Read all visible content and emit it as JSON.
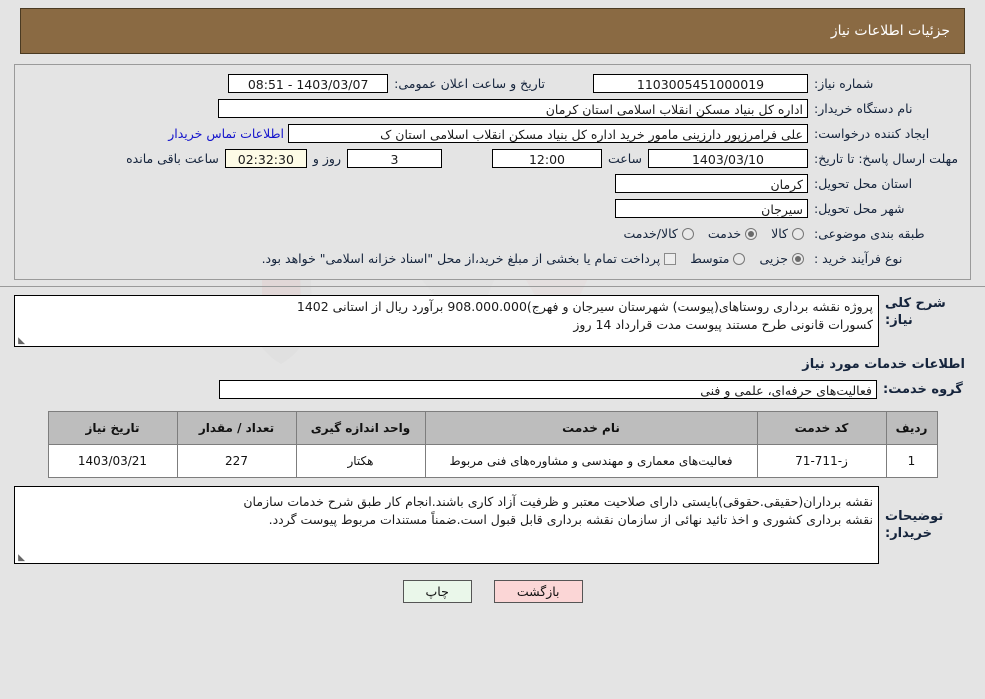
{
  "header": {
    "title": "جزئیات اطلاعات نیاز"
  },
  "fields": {
    "need_number_label": "شماره نیاز:",
    "need_number_value": "1103005451000019",
    "announce_label": "تاریخ و ساعت اعلان عمومی:",
    "announce_value": "1403/03/07 - 08:51",
    "buyer_org_label": "نام دستگاه خریدار:",
    "buyer_org_value": "اداره کل بنیاد مسکن انقلاب اسلامی استان کرمان",
    "creator_label": "ایجاد کننده درخواست:",
    "creator_value": "علی فرامرزپور دارزینی مامور خرید اداره کل بنیاد مسکن انقلاب اسلامی استان ک",
    "contact_link": "اطلاعات تماس خریدار",
    "deadline_label": "مهلت ارسال پاسخ: تا تاریخ:",
    "deadline_date": "1403/03/10",
    "hour_label": "ساعت",
    "hour_value": "12:00",
    "days_value": "3",
    "days_label": "روز و",
    "countdown_value": "02:32:30",
    "remaining_label": "ساعت باقی مانده",
    "province_label": "استان محل تحویل:",
    "province_value": "کرمان",
    "city_label": "شهر محل تحویل:",
    "city_value": "سیرجان",
    "category_label": "طبقه بندی موضوعی:",
    "process_label": "نوع فرآیند خرید :",
    "payment_note": "پرداخت تمام یا بخشی از مبلغ خرید،از محل \"اسناد خزانه اسلامی\" خواهد بود."
  },
  "category_options": [
    {
      "label": "کالا",
      "selected": false
    },
    {
      "label": "خدمت",
      "selected": true
    },
    {
      "label": "کالا/خدمت",
      "selected": false
    }
  ],
  "process_options": [
    {
      "label": "جزیی",
      "selected": true
    },
    {
      "label": "متوسط",
      "selected": false
    }
  ],
  "description": {
    "label": "شرح کلی نیاز:",
    "line1": "پروژه نقشه برداری روستاهای(پیوست) شهرستان سیرجان و فهرج)908.000.000 برآورد  ریال از استانی 1402",
    "line2": "کسورات قانونی طرح مستند  پیوست مدت قرارداد 14 روز"
  },
  "services_section": {
    "title": "اطلاعات خدمات مورد نیاز",
    "group_label": "گروه خدمت:",
    "group_value": "فعالیت‌های حرفه‌ای، علمی و فنی"
  },
  "table": {
    "columns": [
      "ردیف",
      "کد خدمت",
      "نام خدمت",
      "واحد اندازه گیری",
      "تعداد / مقدار",
      "تاریخ نیاز"
    ],
    "rows": [
      {
        "radif": "1",
        "code": "ز-711-71",
        "name": "فعالیت‌های معماری و مهندسی و مشاوره‌های فنی مربوط",
        "unit": "هکتار",
        "qty": "227",
        "date": "1403/03/21"
      }
    ]
  },
  "buyer_notes": {
    "label": "توضیحات خریدار:",
    "line1": "نقشه برداران(حقیقی.حقوقی)بایستی دارای صلاحیت معتبر و ظرفیت آزاد کاری باشند.انجام کار طبق شرح خدمات سازمان",
    "line2": "نقشه برداری کشوری و اخذ تائید نهائی از سازمان نقشه برداری قابل قبول است.ضمناً مستندات مربوط پیوست گردد."
  },
  "buttons": {
    "print": "چاپ",
    "back": "بازگشت"
  },
  "colors": {
    "header_bg": "#8a6a43",
    "link": "#1414cc",
    "print_btn": "#eaf7ea",
    "back_btn": "#fbd6d6",
    "countdown_bg": "#fdfbe6"
  }
}
